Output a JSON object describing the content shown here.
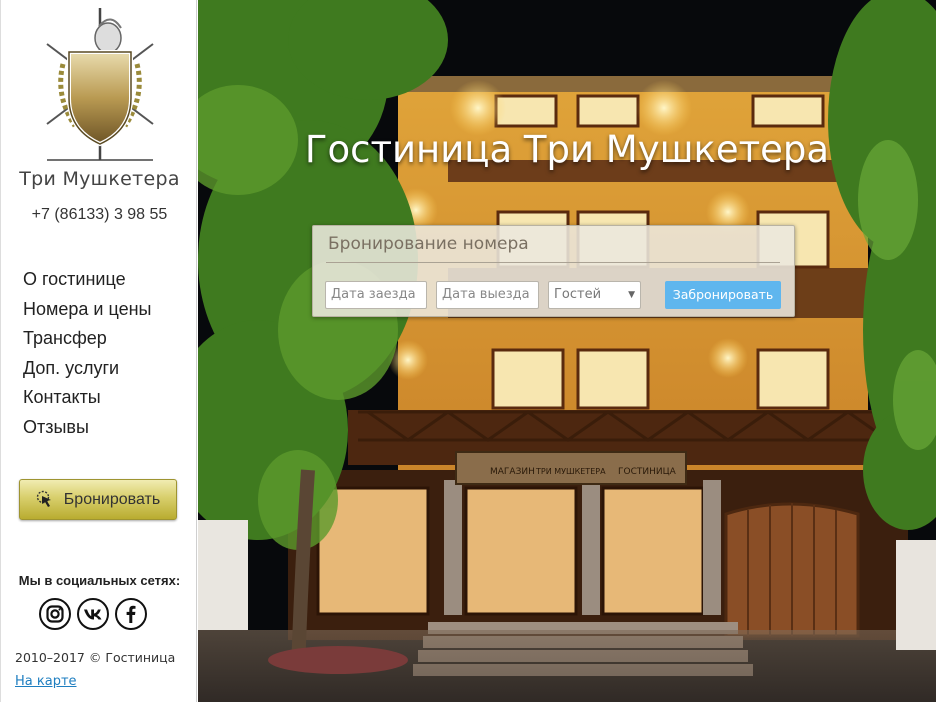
{
  "sidebar": {
    "brand_name": "Три Мушкетера",
    "phone": "+7 (86133) 3 98 55",
    "nav": [
      {
        "label": "О гостинице"
      },
      {
        "label": "Номера и цены"
      },
      {
        "label": "Трансфер"
      },
      {
        "label": "Доп. услуги"
      },
      {
        "label": "Контакты"
      },
      {
        "label": "Отзывы"
      }
    ],
    "book_button": "Бронировать",
    "social_title": "Мы в социальных сетях:",
    "social": [
      {
        "icon": "instagram-icon"
      },
      {
        "icon": "vk-icon"
      },
      {
        "icon": "facebook-icon"
      }
    ],
    "copyright": "2010–2017 © Гостиница",
    "map_link": "На карте"
  },
  "hero": {
    "title": "Гостиница Три Мушкетера",
    "sign_left": "МАГАЗИН",
    "sign_center": "ТРИ МУШКЕТЕРА",
    "sign_right": "ГОСТИНИЦА"
  },
  "booking": {
    "title": "Бронирование номера",
    "checkin_placeholder": "Дата заезда",
    "checkout_placeholder": "Дата выезда",
    "guests_value": "Гостей",
    "submit_label": "Забронировать"
  },
  "colors": {
    "accent_blue": "#5fb6ee",
    "gold_button": "#d8cf6c",
    "link": "#1e7ec0"
  }
}
